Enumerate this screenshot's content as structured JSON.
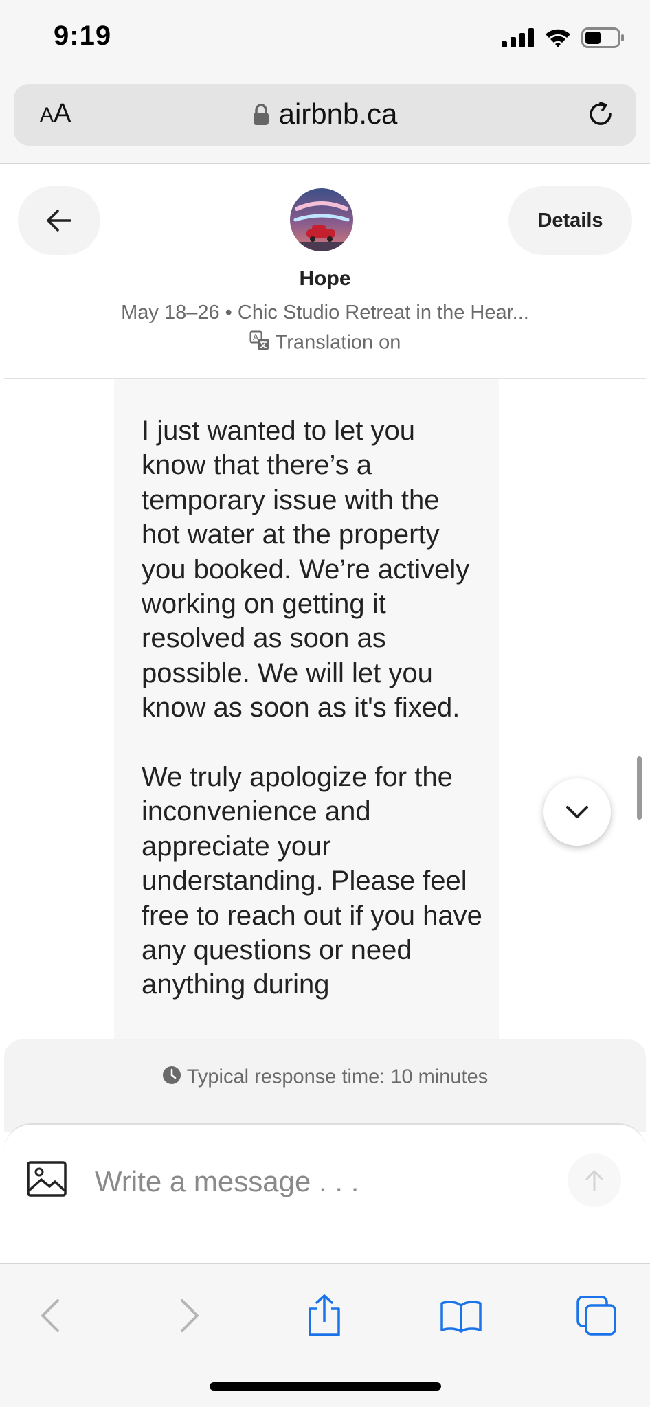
{
  "status_bar": {
    "time": "9:19"
  },
  "browser": {
    "text_size_label_small": "A",
    "text_size_label_large": "A",
    "url": "airbnb.ca"
  },
  "header": {
    "host_name": "Hope",
    "trip_info": "May 18–26 • Chic Studio Retreat in the Hear...",
    "translation_label": "Translation on",
    "details_label": "Details"
  },
  "message": {
    "paragraphs": [
      "I just wanted to let you know that there’s a temporary issue with the hot water at the property you booked. We’re actively working on getting it resolved as soon as possible. We will let you know as soon as it's fixed.",
      "We truly apologize for the inconvenience and appreciate your understanding. Please feel free to reach out if you have any questions or need anything during"
    ]
  },
  "composer": {
    "response_time": "Typical response time: 10 minutes",
    "placeholder": "Write a message . . ."
  },
  "colors": {
    "bubble": "#f7f7f7",
    "accent_safari": "#1a73e8",
    "muted_text": "#6a6a6a"
  }
}
